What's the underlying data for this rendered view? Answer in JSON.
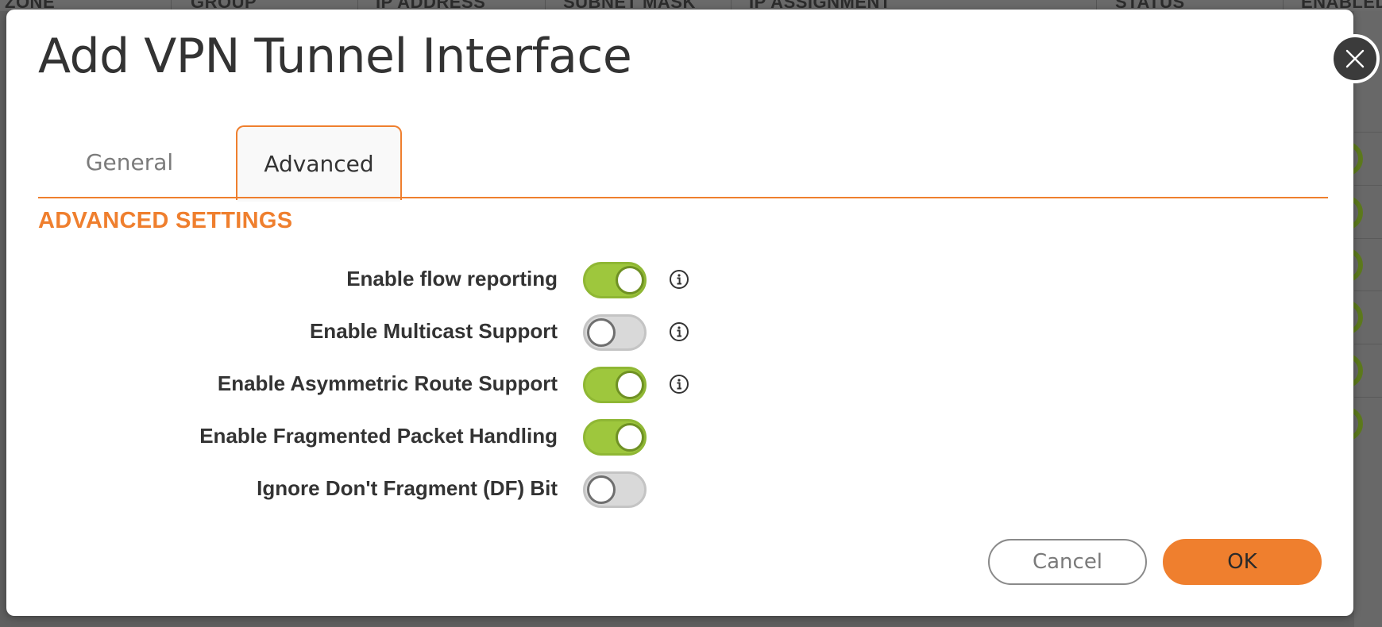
{
  "background_table": {
    "columns": [
      "ZONE",
      "GROUP",
      "IP ADDRESS",
      "SUBNET MASK",
      "IP ASSIGNMENT",
      "STATUS",
      "ENABLED"
    ]
  },
  "dialog": {
    "title": "Add VPN Tunnel Interface",
    "close_icon": "close-icon"
  },
  "tabs": [
    {
      "label": "General",
      "active": false
    },
    {
      "label": "Advanced",
      "active": true
    }
  ],
  "section": {
    "heading": "ADVANCED SETTINGS"
  },
  "settings": [
    {
      "label": "Enable flow reporting",
      "enabled": true,
      "info_icon": true
    },
    {
      "label": "Enable Multicast Support",
      "enabled": false,
      "info_icon": true
    },
    {
      "label": "Enable Asymmetric Route Support",
      "enabled": true,
      "info_icon": true
    },
    {
      "label": "Enable Fragmented Packet Handling",
      "enabled": true,
      "info_icon": false
    },
    {
      "label": "Ignore Don't Fragment (DF) Bit",
      "enabled": false,
      "info_icon": false
    }
  ],
  "footer": {
    "cancel_label": "Cancel",
    "ok_label": "OK"
  },
  "colors": {
    "accent": "#ef7f2e",
    "toggle_on": "#9ec73d",
    "toggle_off": "#d9d9d9",
    "text": "#333333"
  }
}
